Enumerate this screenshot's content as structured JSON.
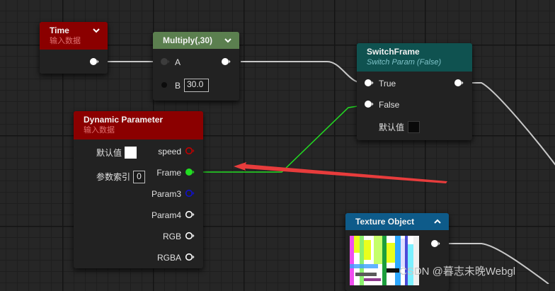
{
  "nodes": {
    "time": {
      "title": "Time",
      "subtitle": "输入数据",
      "header_color": "#8b0000",
      "subtitle_color": "#e07070"
    },
    "multiply": {
      "title": "Multiply(,30)",
      "header_color": "#5b7f4f",
      "pin_a": "A",
      "pin_b": "B",
      "b_value": "30.0"
    },
    "switch_frame": {
      "title": "SwitchFrame",
      "subtitle": "Switch Param (False)",
      "header_color": "#0f5250",
      "subtitle_color": "#7ec2c8",
      "pin_true": "True",
      "pin_false": "False",
      "default_label": "默认值"
    },
    "dynamic_parameter": {
      "title": "Dynamic Parameter",
      "subtitle": "输入数据",
      "header_color": "#8b0000",
      "subtitle_color": "#e07070",
      "default_label": "默认值",
      "index_label": "参数索引",
      "index_value": "0",
      "outputs": [
        "speed",
        "Frame",
        "Param3",
        "Param4",
        "RGB",
        "RGBA"
      ]
    },
    "texture_object": {
      "title": "Texture Object",
      "header_color": "#0e5b8a"
    }
  },
  "colors": {
    "pin_white": "#ffffff",
    "pin_speed": "#c00000",
    "pin_frame": "#22dd22",
    "pin_param3": "#1010d0",
    "wire_white": "#c8c8c8",
    "wire_green": "#22dd22",
    "arrow_red": "#e83c3c"
  },
  "icons": {
    "expand": "chevron-down-icon",
    "collapse": "chevron-up-icon"
  },
  "watermark": "CSDN @暮志未晚Webgl"
}
